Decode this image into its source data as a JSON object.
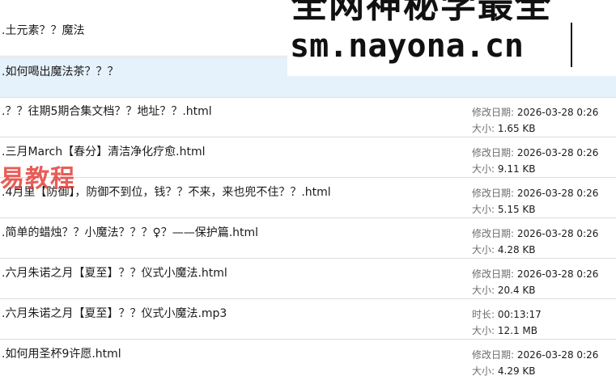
{
  "files": [
    {
      "name": ".土元素？？魔法",
      "meta1_label": "",
      "meta1_value": "",
      "meta2_label": "",
      "meta2_value": ""
    },
    {
      "name": ".如何喝出魔法茶？？？",
      "meta1_label": "",
      "meta1_value": "",
      "meta2_label": "",
      "meta2_value": "",
      "selected": true
    },
    {
      "name": ".？？往期5期合集文档？？地址？？.html",
      "meta1_label": "修改日期:",
      "meta1_value": "2026-03-28 0:26",
      "meta2_label": "大小:",
      "meta2_value": "1.65 KB"
    },
    {
      "name": ".三月March【春分】清洁净化疗愈.html",
      "meta1_label": "修改日期:",
      "meta1_value": "2026-03-28 0:26",
      "meta2_label": "大小:",
      "meta2_value": "9.11 KB"
    },
    {
      "name": ".4月里【防御】，防御不到位，钱？？不来，来也兜不住？？.html",
      "meta1_label": "修改日期:",
      "meta1_value": "2026-03-28 0:26",
      "meta2_label": "大小:",
      "meta2_value": "5.15 KB"
    },
    {
      "name": ".简单的蜡烛？？小魔法？？？♀？——保护篇.html",
      "meta1_label": "修改日期:",
      "meta1_value": "2026-03-28 0:26",
      "meta2_label": "大小:",
      "meta2_value": "4.28 KB"
    },
    {
      "name": ".六月朱诺之月【夏至】？？仪式小魔法.html",
      "meta1_label": "修改日期:",
      "meta1_value": "2026-03-28 0:26",
      "meta2_label": "大小:",
      "meta2_value": "20.4 KB"
    },
    {
      "name": ".六月朱诺之月【夏至】？？仪式小魔法.mp3",
      "meta1_label": "时长:",
      "meta1_value": "00:13:17",
      "meta2_label": "大小:",
      "meta2_value": "12.1 MB"
    },
    {
      "name": ".如何用圣杯9许愿.html",
      "meta1_label": "修改日期:",
      "meta1_value": "2026-03-28 0:26",
      "meta2_label": "大小:",
      "meta2_value": "4.29 KB"
    }
  ],
  "watermark": {
    "top_text": "全网神秘学最全",
    "url_text": "sm.nayona.cn",
    "red_text": "易教程"
  }
}
